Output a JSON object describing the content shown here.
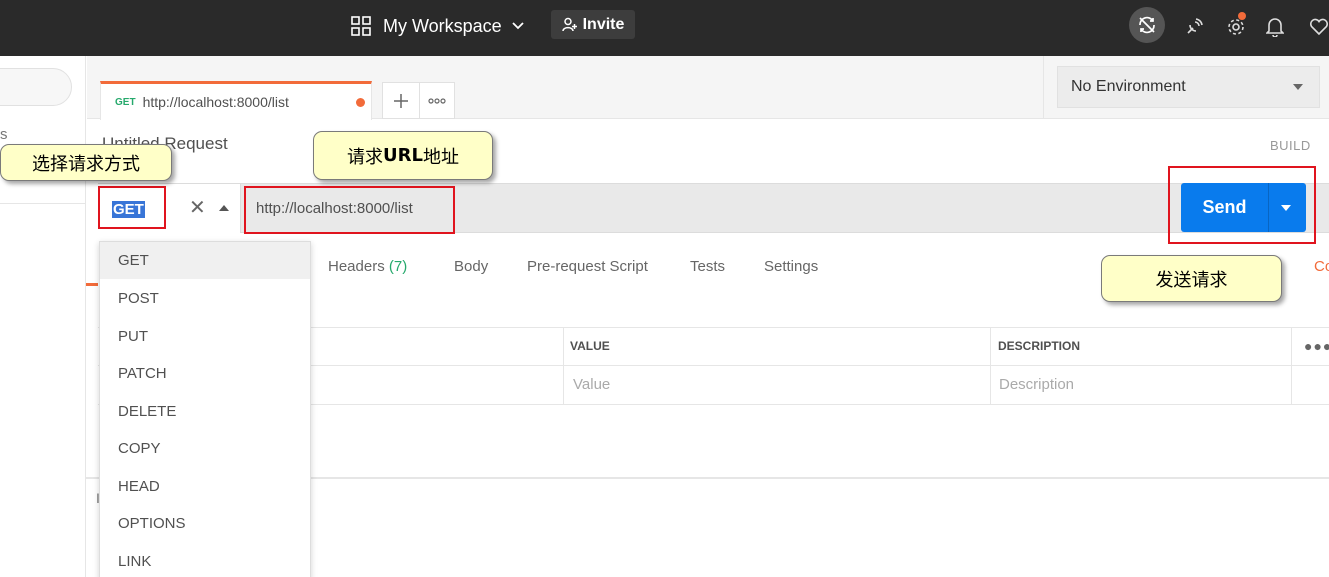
{
  "header": {
    "workspace_label": "My Workspace",
    "invite_label": "Invite",
    "icons": [
      "workspaces-grid-icon",
      "chevron-down-icon",
      "add-user-icon",
      "sync-off-icon",
      "satellite-icon",
      "settings-icon",
      "bell-icon",
      "heart-icon"
    ]
  },
  "sidebar": {
    "partial_label": "s"
  },
  "tabs": {
    "active_tab": {
      "method": "GET",
      "url": "http://localhost:8000/list"
    }
  },
  "environment": {
    "selected": "No Environment"
  },
  "request": {
    "title": "Untitled Request",
    "build_label": "BUILD",
    "method": "GET",
    "url": "http://localhost:8000/list",
    "send_label": "Send"
  },
  "request_tabs": [
    {
      "label": "Headers",
      "count": "(7)"
    },
    {
      "label": "Body"
    },
    {
      "label": "Pre-request Script"
    },
    {
      "label": "Tests"
    },
    {
      "label": "Settings"
    }
  ],
  "request_tabs_partial": "Co",
  "params_table": {
    "value_header": "VALUE",
    "description_header": "DESCRIPTION",
    "value_placeholder": "Value",
    "description_placeholder": "Description"
  },
  "response_partial": "I",
  "method_menu": [
    "GET",
    "POST",
    "PUT",
    "PATCH",
    "DELETE",
    "COPY",
    "HEAD",
    "OPTIONS",
    "LINK"
  ],
  "callouts": {
    "method": "选择请求方式",
    "url_prefix": "请求",
    "url_bold": "URL",
    "url_suffix": "地址",
    "send": "发送请求"
  },
  "colors": {
    "topbar": "#2a2a2a",
    "accent": "#f26b3a",
    "send_blue": "#097bed",
    "method_green": "#26a96c",
    "annotation_red": "#e0141e",
    "callout_fill": "#ffffc8"
  }
}
